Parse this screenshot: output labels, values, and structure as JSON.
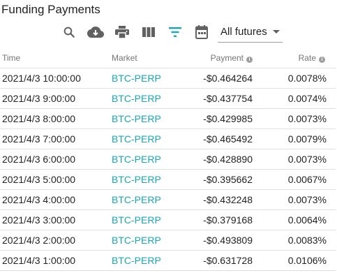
{
  "page": {
    "title": "Funding Payments"
  },
  "toolbar": {
    "icons": [
      "search-icon",
      "cloud-download-icon",
      "print-icon",
      "columns-icon",
      "filter-icon",
      "calendar-icon"
    ],
    "accent_color": "#19a7b8",
    "icon_color": "#616161",
    "filter_value": "All futures"
  },
  "table": {
    "headers": {
      "time": "Time",
      "market": "Market",
      "payment": "Payment",
      "rate": "Rate"
    },
    "rows": [
      {
        "time": "2021/4/3 10:00:00",
        "market": "BTC-PERP",
        "payment": "-$0.464264",
        "rate": "0.0078%"
      },
      {
        "time": "2021/4/3 9:00:00",
        "market": "BTC-PERP",
        "payment": "-$0.437754",
        "rate": "0.0074%"
      },
      {
        "time": "2021/4/3 8:00:00",
        "market": "BTC-PERP",
        "payment": "-$0.429985",
        "rate": "0.0073%"
      },
      {
        "time": "2021/4/3 7:00:00",
        "market": "BTC-PERP",
        "payment": "-$0.465492",
        "rate": "0.0079%"
      },
      {
        "time": "2021/4/3 6:00:00",
        "market": "BTC-PERP",
        "payment": "-$0.428890",
        "rate": "0.0073%"
      },
      {
        "time": "2021/4/3 5:00:00",
        "market": "BTC-PERP",
        "payment": "-$0.395662",
        "rate": "0.0067%"
      },
      {
        "time": "2021/4/3 4:00:00",
        "market": "BTC-PERP",
        "payment": "-$0.432248",
        "rate": "0.0073%"
      },
      {
        "time": "2021/4/3 3:00:00",
        "market": "BTC-PERP",
        "payment": "-$0.379168",
        "rate": "0.0064%"
      },
      {
        "time": "2021/4/3 2:00:00",
        "market": "BTC-PERP",
        "payment": "-$0.493809",
        "rate": "0.0083%"
      },
      {
        "time": "2021/4/3 1:00:00",
        "market": "BTC-PERP",
        "payment": "-$0.631728",
        "rate": "0.0106%"
      }
    ]
  }
}
